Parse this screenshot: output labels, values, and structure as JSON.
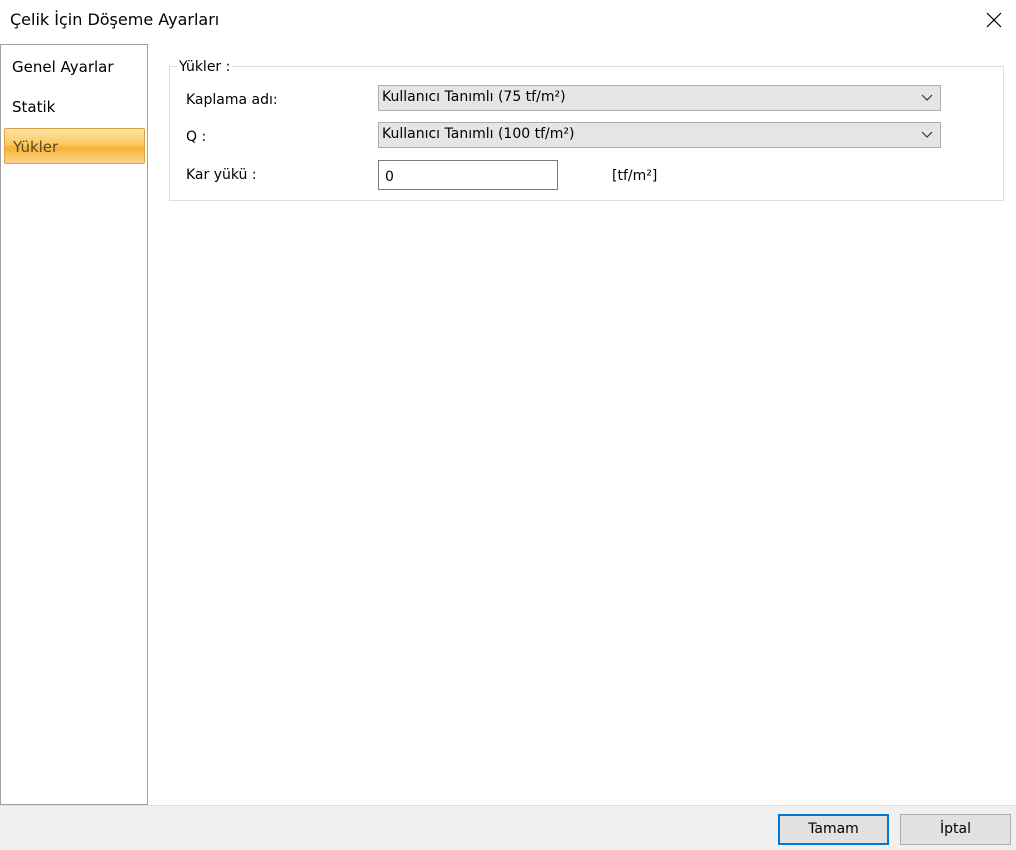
{
  "window": {
    "title": "Çelik İçin Döşeme Ayarları",
    "close_icon": "close-icon"
  },
  "sidebar": {
    "items": [
      {
        "label": "Genel Ayarlar",
        "active": false
      },
      {
        "label": "Statik",
        "active": false
      },
      {
        "label": "Yükler",
        "active": true
      }
    ]
  },
  "loads_group": {
    "legend": "Yükler :",
    "coating": {
      "label": "Kaplama adı:",
      "selected": "Kullanıcı Tanımlı (75 tf/m²)"
    },
    "q": {
      "label": "Q :",
      "selected": "Kullanıcı Tanımlı (100 tf/m²)"
    },
    "snow": {
      "label": "Kar yükü :",
      "value": "0",
      "unit": "[tf/m²]"
    }
  },
  "footer": {
    "ok_label": "Tamam",
    "cancel_label": "İptal"
  },
  "colors": {
    "active_tab": "#fcc961",
    "default_button_border": "#0078d7",
    "footer_bg": "#f0f0f0"
  }
}
